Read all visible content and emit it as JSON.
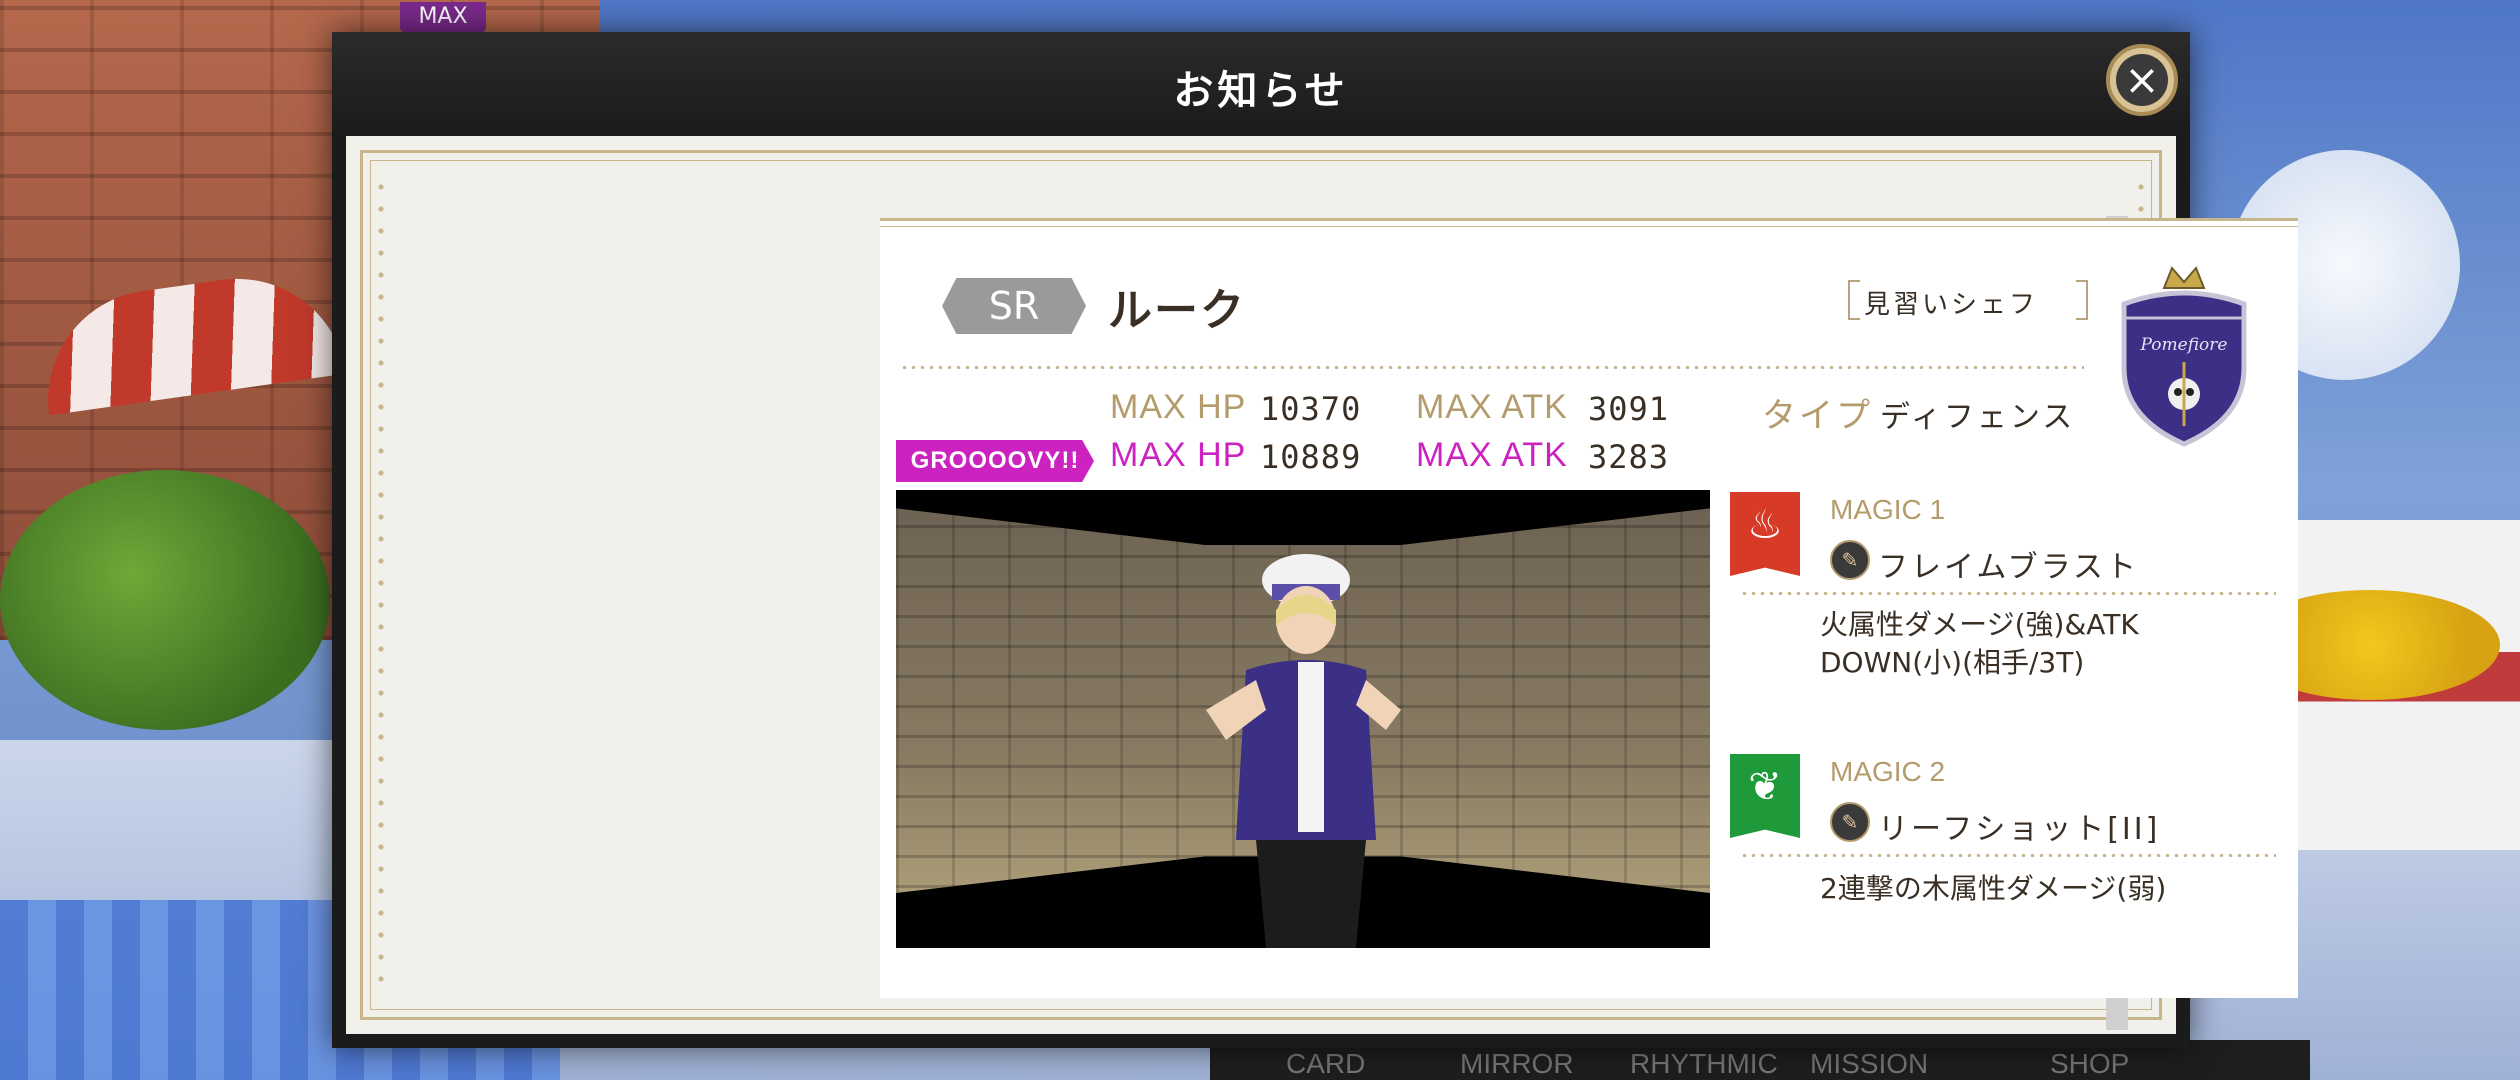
{
  "modal": {
    "title": "お知らせ",
    "close_symbol": "×"
  },
  "background": {
    "max_badge": "MAX",
    "nav": [
      "CARD",
      "MIRROR",
      "RHYTHMIC",
      "MISSION",
      "SHOP"
    ]
  },
  "card": {
    "rarity": "SR",
    "name": "ルーク",
    "title": "見習いシェフ",
    "stats": {
      "hp_label": "MAX HP",
      "hp_value": "10370",
      "atk_label": "MAX ATK",
      "atk_value": "3091",
      "type_label": "タイプ",
      "type_value": "ディフェンス"
    },
    "groovy": {
      "badge": "GROOOOVY!!",
      "hp_label": "MAX HP",
      "hp_value": "10889",
      "atk_label": "MAX ATK",
      "atk_value": "3283"
    },
    "crest_text": "Pomefiore",
    "magic": [
      {
        "label": "MAGIC 1",
        "name": "フレイムブラスト",
        "desc": "火属性ダメージ(強)&ATK DOWN(小)(相手/3T)",
        "icon": "flame-icon",
        "color": "#d73a26"
      },
      {
        "label": "MAGIC 2",
        "name": "リーフショット[II]",
        "desc": "2連撃の木属性ダメージ(弱)",
        "icon": "leaf-icon",
        "color": "#1f9a3a"
      }
    ]
  },
  "scroll": {
    "position": 0.5
  }
}
